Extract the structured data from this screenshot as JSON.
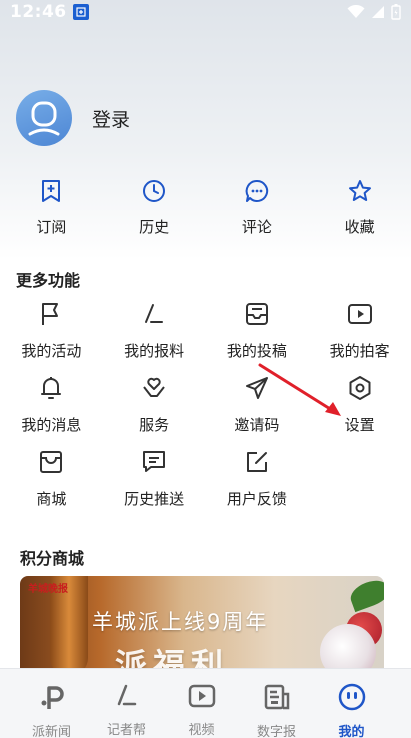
{
  "status_bar": {
    "time": "12:46",
    "app_icon_text": "派"
  },
  "profile": {
    "login_label": "登录"
  },
  "quick_actions": [
    {
      "label": "订阅",
      "icon": "bookmark-plus-icon"
    },
    {
      "label": "历史",
      "icon": "clock-icon"
    },
    {
      "label": "评论",
      "icon": "comment-icon"
    },
    {
      "label": "收藏",
      "icon": "star-icon"
    }
  ],
  "more_functions": {
    "title": "更多功能",
    "items": [
      {
        "label": "我的活动",
        "icon": "flag-icon"
      },
      {
        "label": "我的报料",
        "icon": "pen-slash-icon"
      },
      {
        "label": "我的投稿",
        "icon": "inbox-icon"
      },
      {
        "label": "我的拍客",
        "icon": "video-play-icon"
      },
      {
        "label": "我的消息",
        "icon": "bell-icon"
      },
      {
        "label": "服务",
        "icon": "heart-hands-icon"
      },
      {
        "label": "邀请码",
        "icon": "paper-plane-icon"
      },
      {
        "label": "设置",
        "icon": "hexagon-gear-icon"
      },
      {
        "label": "商城",
        "icon": "shop-box-icon"
      },
      {
        "label": "历史推送",
        "icon": "message-lines-icon"
      },
      {
        "label": "用户反馈",
        "icon": "edit-square-icon"
      }
    ]
  },
  "points_mall": {
    "title": "积分商城",
    "banner": {
      "brand": "羊城晚报",
      "headline": "羊城派上线9周年",
      "sub": "派福利"
    }
  },
  "tab_bar": {
    "items": [
      {
        "label": "派新闻",
        "icon": "p-logo-icon",
        "active": false
      },
      {
        "label": "记者帮",
        "icon": "pen-slash-icon",
        "active": false
      },
      {
        "label": "视频",
        "icon": "video-play-icon",
        "active": false
      },
      {
        "label": "数字报",
        "icon": "newspaper-icon",
        "active": false
      },
      {
        "label": "我的",
        "icon": "face-icon",
        "active": true
      }
    ]
  },
  "colors": {
    "accent": "#1f56c8",
    "annotation": "#e0202a",
    "text": "#222222"
  }
}
